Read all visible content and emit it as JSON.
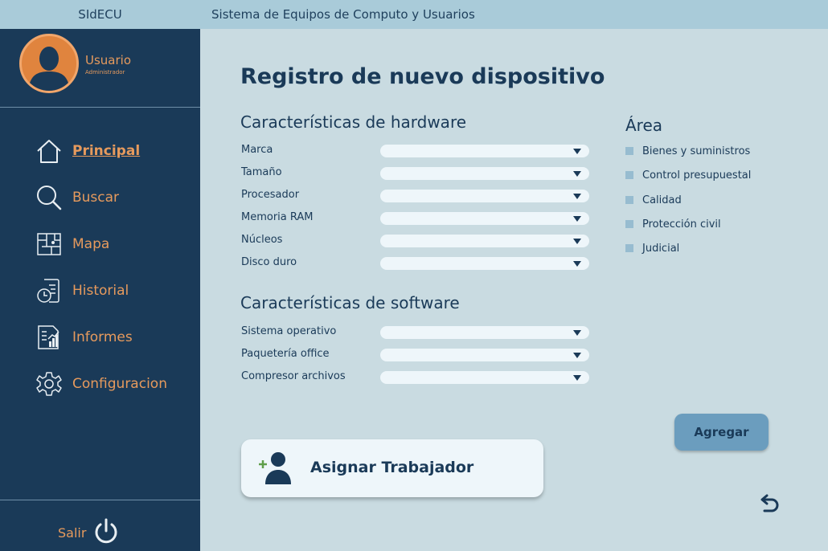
{
  "header": {
    "brand": "SIdECU",
    "title": "Sistema de Equipos de Computo y Usuarios"
  },
  "profile": {
    "name": "Usuario",
    "role": "Administrador"
  },
  "nav": [
    {
      "label": "Principal",
      "icon": "home-icon",
      "active": true
    },
    {
      "label": "Buscar",
      "icon": "search-icon",
      "active": false
    },
    {
      "label": "Mapa",
      "icon": "map-icon",
      "active": false
    },
    {
      "label": "Historial",
      "icon": "history-icon",
      "active": false
    },
    {
      "label": "Informes",
      "icon": "report-icon",
      "active": false
    },
    {
      "label": "Configuracion",
      "icon": "gear-icon",
      "active": false
    }
  ],
  "logout": {
    "label": "Salir",
    "icon": "power-icon"
  },
  "main": {
    "title": "Registro de nuevo dispositivo",
    "hardware": {
      "title": "Características de hardware",
      "fields": [
        {
          "label": "Marca",
          "value": ""
        },
        {
          "label": "Tamaño",
          "value": ""
        },
        {
          "label": "Procesador",
          "value": ""
        },
        {
          "label": "Memoria RAM",
          "value": ""
        },
        {
          "label": "Núcleos",
          "value": ""
        },
        {
          "label": "Disco duro",
          "value": ""
        }
      ]
    },
    "software": {
      "title": "Características de software",
      "fields": [
        {
          "label": "Sistema operativo",
          "value": ""
        },
        {
          "label": "Paquetería office",
          "value": ""
        },
        {
          "label": "Compresor archivos",
          "value": ""
        }
      ]
    },
    "area": {
      "title": "Área",
      "options": [
        {
          "label": "Bienes y suministros",
          "checked": false
        },
        {
          "label": "Control presupuestal",
          "checked": false
        },
        {
          "label": "Calidad",
          "checked": false
        },
        {
          "label": "Protección civil",
          "checked": false
        },
        {
          "label": "Judicial",
          "checked": false
        }
      ]
    },
    "add_button": "Agregar",
    "assign_button": "Asignar Trabajador",
    "back_icon": "undo-icon"
  },
  "colors": {
    "sidebar": "#1a3a58",
    "accent": "#e69a5d",
    "background": "#c9dbe1",
    "topbar": "#a9cbd9"
  }
}
